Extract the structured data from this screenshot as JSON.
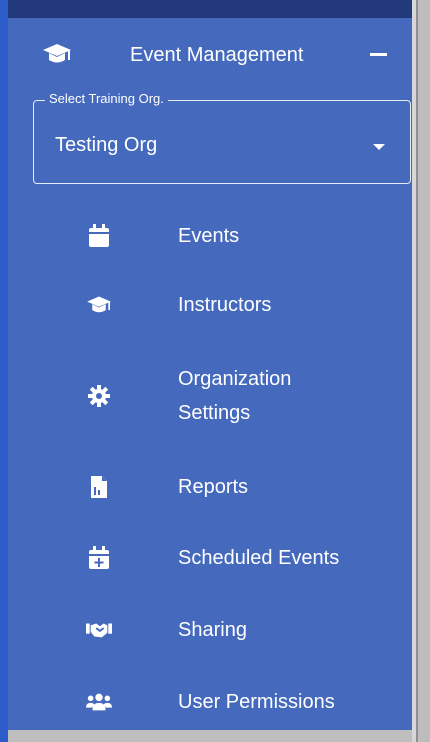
{
  "app": {
    "section_title": "Event Management",
    "collapse_symbol": "−"
  },
  "org_select": {
    "label": "Select Training Org.",
    "value": "Testing Org"
  },
  "nav": [
    {
      "id": "events",
      "label": "Events",
      "icon": "calendar-icon"
    },
    {
      "id": "instructors",
      "label": "Instructors",
      "icon": "graduation-cap-icon"
    },
    {
      "id": "organization-settings",
      "label": "Organization Settings",
      "icon": "gear-icon"
    },
    {
      "id": "reports",
      "label": "Reports",
      "icon": "report-file-icon"
    },
    {
      "id": "scheduled-events",
      "label": "Scheduled Events",
      "icon": "calendar-plus-icon"
    },
    {
      "id": "sharing",
      "label": "Sharing",
      "icon": "handshake-icon"
    },
    {
      "id": "user-permissions",
      "label": "User Permissions",
      "icon": "users-icon"
    }
  ],
  "colors": {
    "sidebar_bg": "#4469bd",
    "top_bar": "#22397c",
    "text": "#ffffff",
    "scroll_track": "#bdbdbd"
  }
}
